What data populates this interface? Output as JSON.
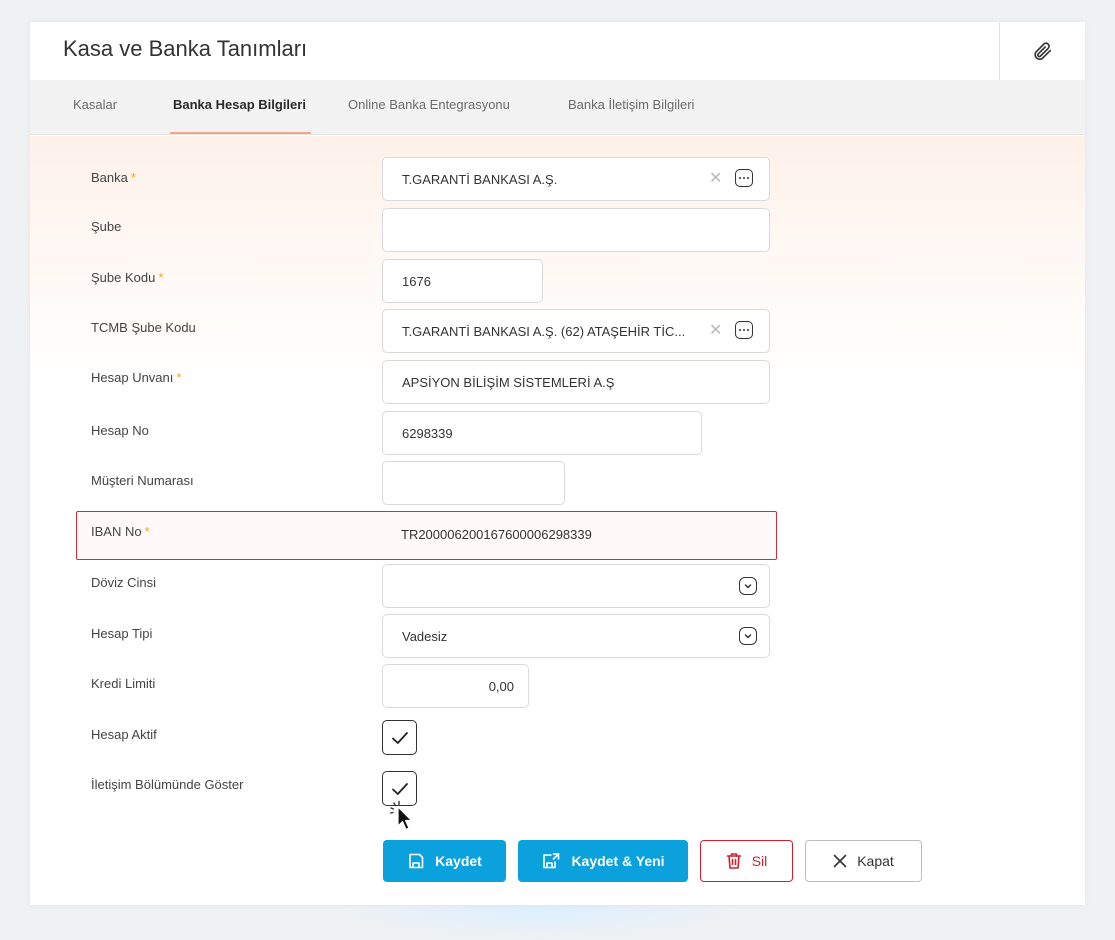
{
  "window": {
    "title": "Kasa ve Banka Tanımları",
    "attach_icon": "paperclip-icon"
  },
  "tabs": [
    {
      "label": "Kasalar",
      "active": false
    },
    {
      "label": "Banka Hesap Bilgileri",
      "active": true
    },
    {
      "label": "Online Banka Entegrasyonu",
      "active": false
    },
    {
      "label": "Banka İletişim Bilgileri",
      "active": false
    }
  ],
  "form": {
    "banka": {
      "label": "Banka",
      "required": "*",
      "value": "T.GARANTİ BANKASI A.Ş."
    },
    "sube": {
      "label": "Şube",
      "value": ""
    },
    "sube_kodu": {
      "label": "Şube Kodu",
      "required": "*",
      "value": "1676"
    },
    "tcmb_sube_kodu": {
      "label": "TCMB Şube Kodu",
      "value": "T.GARANTİ BANKASI A.Ş. (62) ATAŞEHİR TİC..."
    },
    "hesap_unvani": {
      "label": "Hesap Unvanı",
      "required": "*",
      "value": "APSİYON BİLİŞİM SİSTEMLERİ A.Ş"
    },
    "hesap_no": {
      "label": "Hesap No",
      "value": "6298339"
    },
    "musteri_numarasi": {
      "label": "Müşteri Numarası",
      "value": ""
    },
    "iban_no": {
      "label": "IBAN No",
      "required": "*",
      "value": "TR200006200167600006298339",
      "state": "error"
    },
    "doviz_cinsi": {
      "label": "Döviz Cinsi",
      "value": ""
    },
    "hesap_tipi": {
      "label": "Hesap Tipi",
      "value": "Vadesiz"
    },
    "kredi_limiti": {
      "label": "Kredi Limiti",
      "value": "0,00"
    },
    "hesap_aktif": {
      "label": "Hesap Aktif",
      "checked": true
    },
    "iletisim_goster": {
      "label": "İletişim Bölümünde Göster",
      "checked": true
    }
  },
  "buttons": {
    "save": "Kaydet",
    "save_new": "Kaydet & Yeni",
    "delete": "Sil",
    "close": "Kapat"
  },
  "colors": {
    "primary": "#0aa1dc",
    "danger": "#d0202e",
    "required": "#f5a623",
    "tab_underline": "#f0a88c"
  }
}
